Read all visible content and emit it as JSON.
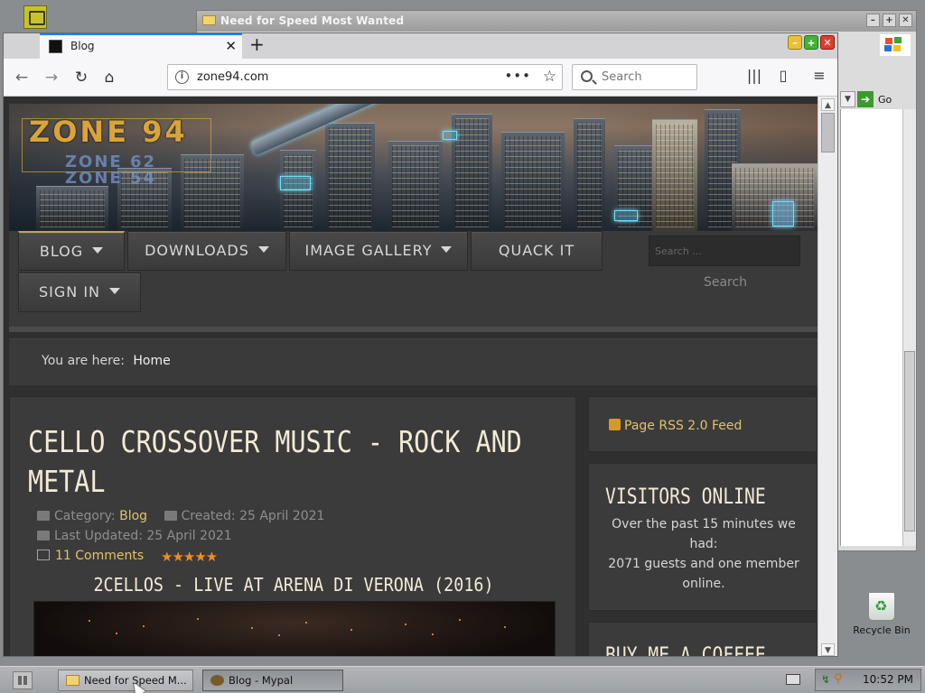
{
  "desktop": {
    "recycle_bin_label": "Recycle Bin"
  },
  "bg_window": {
    "title": "Need for Speed Most Wanted",
    "go_label": "Go"
  },
  "browser": {
    "tab_title": "Blog",
    "url": "zone94.com",
    "search_placeholder": "Search",
    "url_dots": "•••"
  },
  "site": {
    "logo_main": "ZONE 94",
    "logo_sub1": "ZONE 62",
    "logo_sub2": "ZONE 54",
    "menu": {
      "blog": "BLOG",
      "downloads": "DOWNLOADS",
      "image_gallery": "IMAGE GALLERY",
      "quack_it": "QUACK IT",
      "sign_in": "SIGN IN"
    },
    "search_placeholder": "Search ...",
    "search_button": "Search",
    "breadcrumb": {
      "prefix": "You are here:",
      "home": "Home"
    },
    "article": {
      "title": "CELLO CROSSOVER MUSIC - ROCK AND METAL",
      "category_label": "Category:",
      "category_value": "Blog",
      "created": "Created: 25 April 2021",
      "updated": "Last Updated: 25 April 2021",
      "comments": "11 Comments",
      "rating": 5,
      "stars": "★★★★★",
      "subheading": "2CELLOS - LIVE AT ARENA DI VERONA (2016)"
    },
    "sidebar": {
      "rss": "Page RSS 2.0 Feed",
      "visitors_title": "VISITORS ONLINE",
      "visitors_text1": "Over the past 15 minutes we had:",
      "visitors_text2": "2071 guests and one member online.",
      "coffee_title": "BUY ME A COFFEE"
    }
  },
  "taskbar": {
    "task1": "Need for Speed M...",
    "task2": "Blog - Mypal",
    "clock": "10:52 PM"
  }
}
